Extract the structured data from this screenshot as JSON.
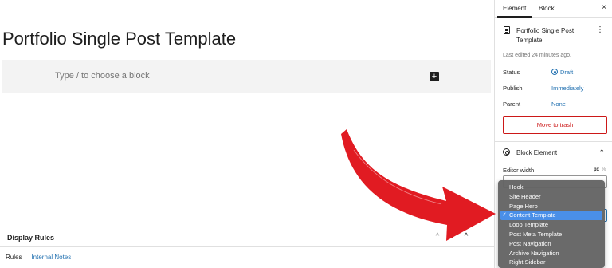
{
  "editor": {
    "post_title": "Portfolio Single Post Template",
    "block_placeholder": "Type / to choose a block",
    "add_block_symbol": "+"
  },
  "display_rules": {
    "title": "Display Rules",
    "controls": [
      "^",
      "v",
      "^"
    ],
    "tabs": [
      "Rules",
      "Internal Notes"
    ]
  },
  "sidebar": {
    "tabs": [
      "Element",
      "Block"
    ],
    "close_symbol": "×",
    "document_title": "Portfolio Single Post Template",
    "kebab_symbol": "⋮",
    "last_edited": "Last edited 24 minutes ago.",
    "status_label": "Status",
    "status_value": "Draft",
    "publish_label": "Publish",
    "publish_value": "Immediately",
    "parent_label": "Parent",
    "parent_value": "None",
    "trash_button": "Move to trash",
    "block_element_title": "Block Element",
    "editor_width_label": "Editor width",
    "unit_px": "px",
    "unit_pct": "%"
  },
  "dropdown": {
    "options": [
      "Hook",
      "Site Header",
      "Page Hero",
      "Content Template",
      "Loop Template",
      "Post Meta Template",
      "Post Navigation",
      "Archive Navigation",
      "Right Sidebar"
    ],
    "selected": "Content Template",
    "check_symbol": "✓"
  },
  "colors": {
    "link_blue": "#2271b1",
    "danger_red": "#cc1818",
    "arrow_red": "#e11b22",
    "dropdown_bg": "#646464",
    "dropdown_selected": "#4a8fe8"
  }
}
